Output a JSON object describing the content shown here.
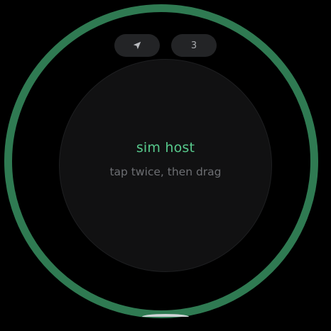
{
  "ring": {
    "color": "#2f7a52"
  },
  "buttons": {
    "location": {
      "icon": "navigation-arrow-icon"
    },
    "count": {
      "label": "3"
    }
  },
  "center": {
    "title": "sim host",
    "hint": "tap twice, then drag"
  },
  "colors": {
    "accent": "#57c98c",
    "background": "#000000",
    "disc": "#111112",
    "button": "#232426",
    "muted_text": "#6d6f73"
  }
}
